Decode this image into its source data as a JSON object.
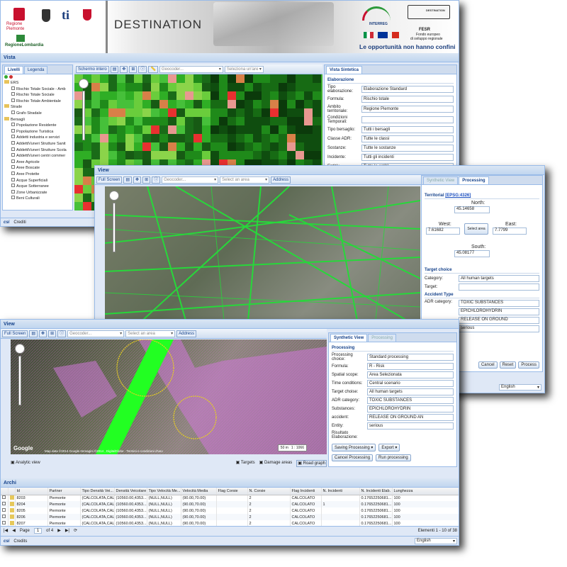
{
  "banner": {
    "title": "DESTINATION",
    "region1": "Regione Piemonte",
    "region2": "RegioneLombardia",
    "logo_ti": "ti",
    "interreg": "INTERREG",
    "destination_badge": "DESTINATION",
    "fesr_title": "FESR",
    "fesr_line1": "Fondo europeo",
    "fesr_line2": "di sviluppo regionale",
    "slogan": "Le opportunità non hanno confini"
  },
  "win1": {
    "vista_label": "Vista",
    "tabs": [
      "Livelli",
      "Legenda"
    ],
    "toolbar_full": "Schermo intero",
    "geocoder": "Geocoder...",
    "area": "Seleziona un'are",
    "tree": [
      {
        "label": "ERS",
        "level": 0,
        "type": "folder"
      },
      {
        "label": "Rischio Totale Sociale - Amb",
        "level": 1,
        "type": "check"
      },
      {
        "label": "Rischio Totale Sociale",
        "level": 1,
        "type": "check"
      },
      {
        "label": "Rischio Totale Ambientale",
        "level": 1,
        "type": "check"
      },
      {
        "label": "Strade",
        "level": 0,
        "type": "folder"
      },
      {
        "label": "Grafo Stradale",
        "level": 1,
        "type": "check"
      },
      {
        "label": "Bersagli",
        "level": 0,
        "type": "folder"
      },
      {
        "label": "Popolazione Residente",
        "level": 1,
        "type": "check"
      },
      {
        "label": "Popolazione Turistica",
        "level": 1,
        "type": "check"
      },
      {
        "label": "Addetti industria e servizi",
        "level": 1,
        "type": "check"
      },
      {
        "label": "AddettiVuneri Strutture Sanit",
        "level": 1,
        "type": "check"
      },
      {
        "label": "AddettiVuneri Strutture Scola",
        "level": 1,
        "type": "check"
      },
      {
        "label": "AddettiVuneri centri commer",
        "level": 1,
        "type": "check"
      },
      {
        "label": "Aree Agricole",
        "level": 1,
        "type": "check"
      },
      {
        "label": "Aree Boscate",
        "level": 1,
        "type": "check"
      },
      {
        "label": "Aree Protette",
        "level": 1,
        "type": "check"
      },
      {
        "label": "Acque Superficiali",
        "level": 1,
        "type": "check"
      },
      {
        "label": "Acque Sotterranee",
        "level": 1,
        "type": "check"
      },
      {
        "label": "Zone Urbanizzate",
        "level": 1,
        "type": "check"
      },
      {
        "label": "Beni Culturali",
        "level": 1,
        "type": "check"
      }
    ],
    "synthetic_tab": "Vista Sintetica",
    "section": "Elaborazione",
    "fields": [
      {
        "label": "Tipo elaborazione:",
        "value": "Elaborazione Standard"
      },
      {
        "label": "Formula:",
        "value": "Rischio totale"
      },
      {
        "label": "Ambito territoriale:",
        "value": "Regione Piemonte"
      },
      {
        "label": "Condizioni Temporali:",
        "value": ""
      },
      {
        "label": "Tipo bersaglio:",
        "value": "Tutti i bersagli"
      },
      {
        "label": "Classe ADR:",
        "value": "Tutte le classi"
      },
      {
        "label": "Sostanze:",
        "value": "Tutte le sostanze"
      },
      {
        "label": "Incidente:",
        "value": "Tutti gli incidenti"
      },
      {
        "label": "Entità:",
        "value": "Tutte le entità"
      }
    ],
    "csi": "csi",
    "credits": "Crediti"
  },
  "win2": {
    "view_label": "View",
    "full_screen": "Full Screen",
    "geocoder": "Geocoder...",
    "area": "Select an area",
    "address": "Address",
    "tabs": [
      "Synthetic View",
      "Processing"
    ],
    "territorial": "Territorial",
    "epsg": "[EPSG:4326]",
    "north_label": "North:",
    "north": "45.14658",
    "west_label": "West:",
    "west": "7.61682",
    "east_label": "East:",
    "east": "7.7799",
    "south_label": "South:",
    "south": "45.08177",
    "select_area_btn": "Select area",
    "target_choice": "Target choice",
    "category_label": "Category:",
    "category": "All human targets",
    "target_label": "Target:",
    "target": "",
    "accident_type": "Accident Type",
    "adr_label": "ADR category:",
    "adr_values": [
      "TOXIC SUBSTANCES",
      "EPICHLOROHYDRIN",
      "RELEASE ON GROUND",
      "serious"
    ],
    "cancel": "Cancel",
    "reset": "Reset",
    "process": "Process",
    "language": "English"
  },
  "win3": {
    "view_label": "View",
    "full_screen": "Full Screen",
    "geocoder": "Geocoder...",
    "area": "Select an area",
    "address": "Address",
    "tabs": [
      "Synthetic View",
      "Processing"
    ],
    "section": "Processing",
    "fields": [
      {
        "label": "Processing choice:",
        "value": "Standard processing"
      },
      {
        "label": "Formula:",
        "value": "R - Risk"
      },
      {
        "label": "Spatial scope:",
        "value": "Area Selezionata"
      },
      {
        "label": "Time conditions:",
        "value": "Central scenario"
      },
      {
        "label": "Target choise:",
        "value": "All human targets"
      },
      {
        "label": "ADR category:",
        "value": "TOXIC SUBSTANCES"
      },
      {
        "label": "Substances:",
        "value": "EPICHLOROHYDRIN"
      },
      {
        "label": "accident:",
        "value": "RELEASE ON GROUND AN"
      },
      {
        "label": "Entity:",
        "value": "serious"
      }
    ],
    "risultato": "Risultato Elaborazione:",
    "saving": "Saving Processing",
    "export": "Export",
    "cancel_processing": "Cancel Processing",
    "run_processing": "Run processing",
    "analytic": "Analytic view",
    "targets": "Targets",
    "damage": "Damage areas",
    "road": "Road graph",
    "scale_label": "50 m",
    "scale_ratio": "1 : 1066",
    "google": "Google",
    "attribution": "Map data ©2014 Google Immagini ©2014 , DigitalGlobe · Termini e condizioni d'uso",
    "arcs_label": "Archi",
    "columns": [
      "Id",
      "Partner",
      "Tipo Densità Vei...",
      "Densità Veicolare",
      "Tipo Velocità Me...",
      "Velocità Media",
      "Flag Corsie",
      "N. Corsie",
      "Flag Incidenti",
      "N. Incidenti",
      "N. Incidenti Elab.",
      "Lunghezza",
      "Elenco Dissesti"
    ],
    "rows": [
      [
        "8203",
        "Piemonte",
        "(CALCOLATA,CAL...",
        "(10560.00,4353...",
        "(NULL,NULL)",
        "(90.00,70.00)",
        "",
        "2",
        "CALCOLATO",
        "",
        "0.17652250681...",
        "100",
        "(\"Fasce PAI - ..."
      ],
      [
        "8204",
        "Piemonte",
        "(CALCOLATA,CAL...",
        "(10560.00,4353...",
        "(NULL,NULL)",
        "(90.00,70.00)",
        "",
        "2",
        "CALCOLATO",
        "1",
        "0.17652250681...",
        "100",
        "(\"Fasce PAI - ..."
      ],
      [
        "8205",
        "Piemonte",
        "(CALCOLATA,CAL...",
        "(10560.00,4353...",
        "(NULL,NULL)",
        "(90.00,70.00)",
        "",
        "2",
        "CALCOLATO",
        "",
        "0.17652250681...",
        "100",
        "(\"Fasce PAI - ..."
      ],
      [
        "8206",
        "Piemonte",
        "(CALCOLATA,CAL...",
        "(10560.00,4353...",
        "(NULL,NULL)",
        "(90.00,70.00)",
        "",
        "2",
        "CALCOLATO",
        "",
        "0.17652250681...",
        "100",
        "(\"Fasce PAI - ..."
      ],
      [
        "8207",
        "Piemonte",
        "(CALCOLATA,CAL...",
        "(10560.00,4353...",
        "(NULL,NULL)",
        "(90.00,70.00)",
        "",
        "2",
        "CALCOLATO",
        "",
        "0.17652250681...",
        "100",
        "(\"Fasce PAI - ..."
      ]
    ],
    "page_label": "Page",
    "page_num": "1",
    "page_of": "of 4",
    "elements": "Elementi 1 - 10 of 38",
    "csi": "csi",
    "credits": "Credits",
    "language": "English"
  }
}
